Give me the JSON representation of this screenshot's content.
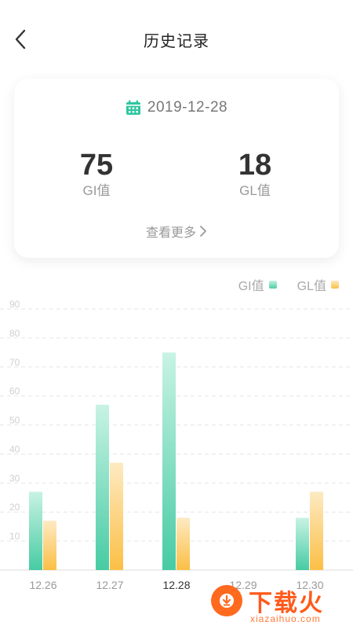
{
  "header": {
    "title": "历史记录",
    "back_icon": "chevron-left-icon"
  },
  "summary": {
    "date": "2019-12-28",
    "calendar_icon": "calendar-icon",
    "gi": {
      "value": "75",
      "label": "GI值"
    },
    "gl": {
      "value": "18",
      "label": "GL值"
    },
    "more_label": "查看更多"
  },
  "colors": {
    "accent": "#2ec7a0",
    "gi_top": "#c3f2e2",
    "gi_bottom": "#4ecda6",
    "gl_top": "#fde9bd",
    "gl_bottom": "#fcc04a"
  },
  "chart_data": {
    "type": "bar",
    "categories": [
      "12.26",
      "12.27",
      "12.28",
      "12.29",
      "12.30"
    ],
    "series": [
      {
        "name": "GI值",
        "values": [
          27,
          57,
          75,
          0,
          18
        ]
      },
      {
        "name": "GL值",
        "values": [
          17,
          37,
          18,
          0,
          27
        ]
      }
    ],
    "y_ticks": [
      "10",
      "20",
      "30",
      "40",
      "50",
      "60",
      "70",
      "80",
      "90"
    ],
    "ylim": [
      0,
      90
    ],
    "grid": true,
    "legend": "top-right",
    "active_category": "12.28"
  },
  "watermark": {
    "text": "下载火",
    "sub": "xiazaihuo.com"
  }
}
